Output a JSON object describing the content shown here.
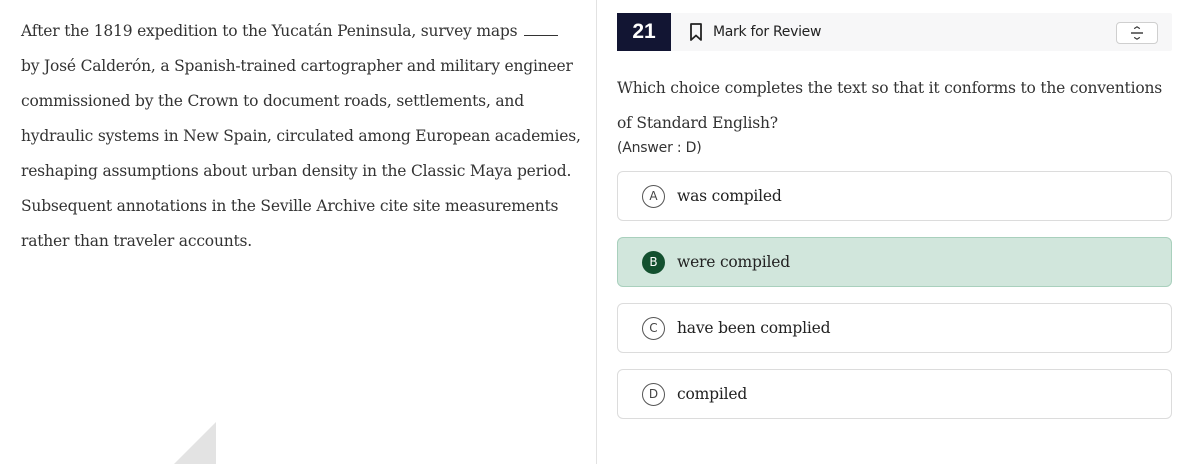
{
  "passage": {
    "part1": "After the 1819 expedition to the Yucatán Peninsula, survey maps",
    "part2": "by José Calderón, a Spanish-trained cartographer and military engineer commissioned by the Crown to document roads, settlements, and hydraulic systems in New Spain, circulated among European academies, reshaping assumptions about urban density in the Classic Maya period. Subsequent annotations in the Seville Archive cite site measurements rather than traveler accounts."
  },
  "header": {
    "question_number": "21",
    "mark_review_label": "Mark for Review",
    "bookmark_icon": "bookmark-icon",
    "strikethrough_icon": "strikethrough-icon"
  },
  "question": {
    "prompt": "Which choice completes the text so that it conforms to the conventions of Standard English?",
    "answer_note": "(Answer : D)"
  },
  "choices": [
    {
      "letter": "A",
      "text": "was compiled",
      "selected": false
    },
    {
      "letter": "B",
      "text": "were compiled",
      "selected": true
    },
    {
      "letter": "C",
      "text": "have been complied",
      "selected": false
    },
    {
      "letter": "D",
      "text": "compiled",
      "selected": false
    }
  ],
  "colors": {
    "number_badge": "#121533",
    "selected_fill": "#d1e6dc",
    "selected_letter": "#13502f"
  }
}
